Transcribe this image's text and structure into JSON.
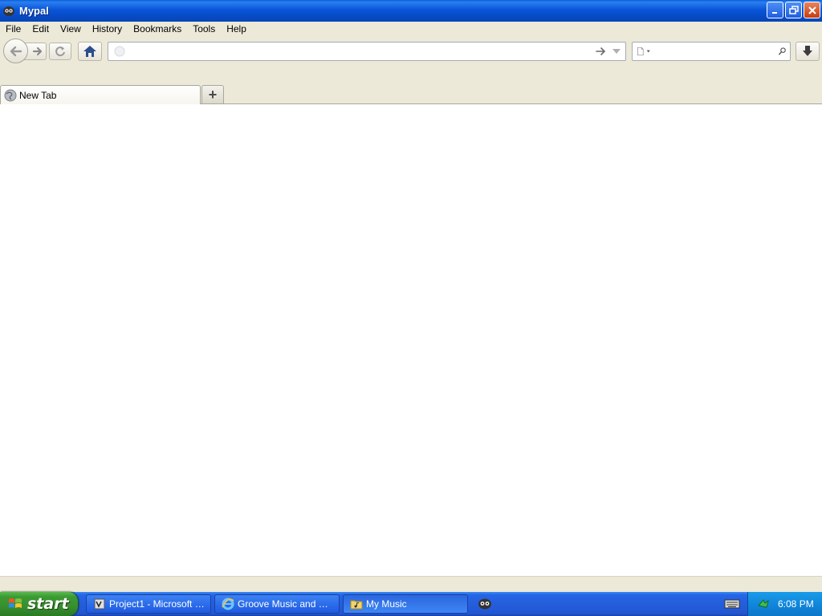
{
  "window": {
    "title": "Mypal",
    "controls": {
      "minimize": "minimize-icon",
      "restore": "restore-icon",
      "close": "close-icon"
    }
  },
  "menubar": {
    "items": [
      {
        "label": "File"
      },
      {
        "label": "Edit"
      },
      {
        "label": "View"
      },
      {
        "label": "History"
      },
      {
        "label": "Bookmarks"
      },
      {
        "label": "Tools"
      },
      {
        "label": "Help"
      }
    ]
  },
  "toolbar": {
    "url_value": "",
    "url_placeholder": "",
    "search_value": "",
    "search_placeholder": "",
    "icons": [
      "back-arrow-icon",
      "forward-arrow-icon",
      "reload-icon",
      "home-icon",
      "go-arrow-icon",
      "dropdown-icon",
      "search-engine-icon",
      "search-icon",
      "download-icon"
    ]
  },
  "tabs": {
    "items": [
      {
        "label": "New Tab",
        "icon": "globe-icon"
      }
    ],
    "new_tab_label": "+"
  },
  "taskbar": {
    "start_label": "start",
    "tasks": [
      {
        "label": "Project1 - Microsoft V...",
        "icon": "vb-project-icon"
      },
      {
        "label": "Groove Music and Sp...",
        "icon": "ie-icon"
      },
      {
        "label": "My Music",
        "icon": "folder-icon"
      }
    ],
    "clock": "6:08 PM"
  },
  "colors": {
    "titlebar": "#0a55d8",
    "taskbar": "#245edb",
    "start": "#3c9b33",
    "tray": "#0f83d8",
    "chrome": "#ece9d8"
  }
}
